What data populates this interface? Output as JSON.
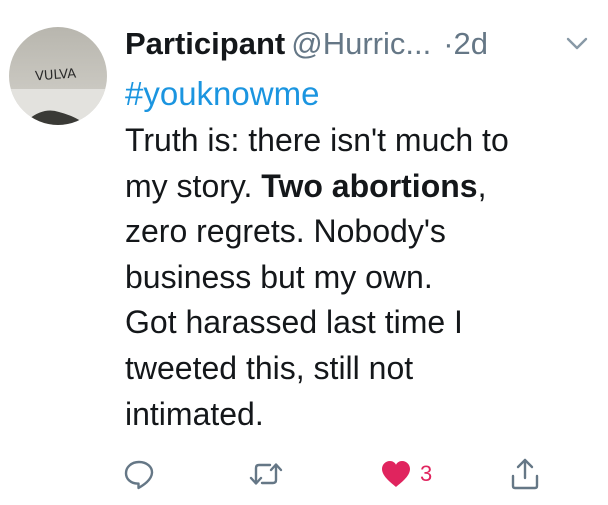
{
  "tweet": {
    "display_name": "Participant",
    "handle": "@Hurric...",
    "separator": "·",
    "timestamp": "2d",
    "avatar_text": "VULVA",
    "hashtag": "#youknowme",
    "body_lines": [
      [
        "Truth is: there isn't much to"
      ],
      [
        "my story. ",
        "Two abortions",
        ","
      ],
      [
        "zero regrets. Nobody's"
      ],
      [
        "business but my own."
      ],
      [
        "Got harassed last time I"
      ],
      [
        "tweeted this, still not"
      ],
      [
        "intimated."
      ]
    ],
    "like_count": "3"
  },
  "colors": {
    "hashtag": "#1b95e0",
    "meta_gray": "#657786",
    "like_red": "#e0245e"
  },
  "icons": {
    "reply": "reply-icon",
    "retweet": "retweet-icon",
    "like": "heart-icon",
    "share": "share-icon",
    "menu": "chevron-down-icon"
  }
}
